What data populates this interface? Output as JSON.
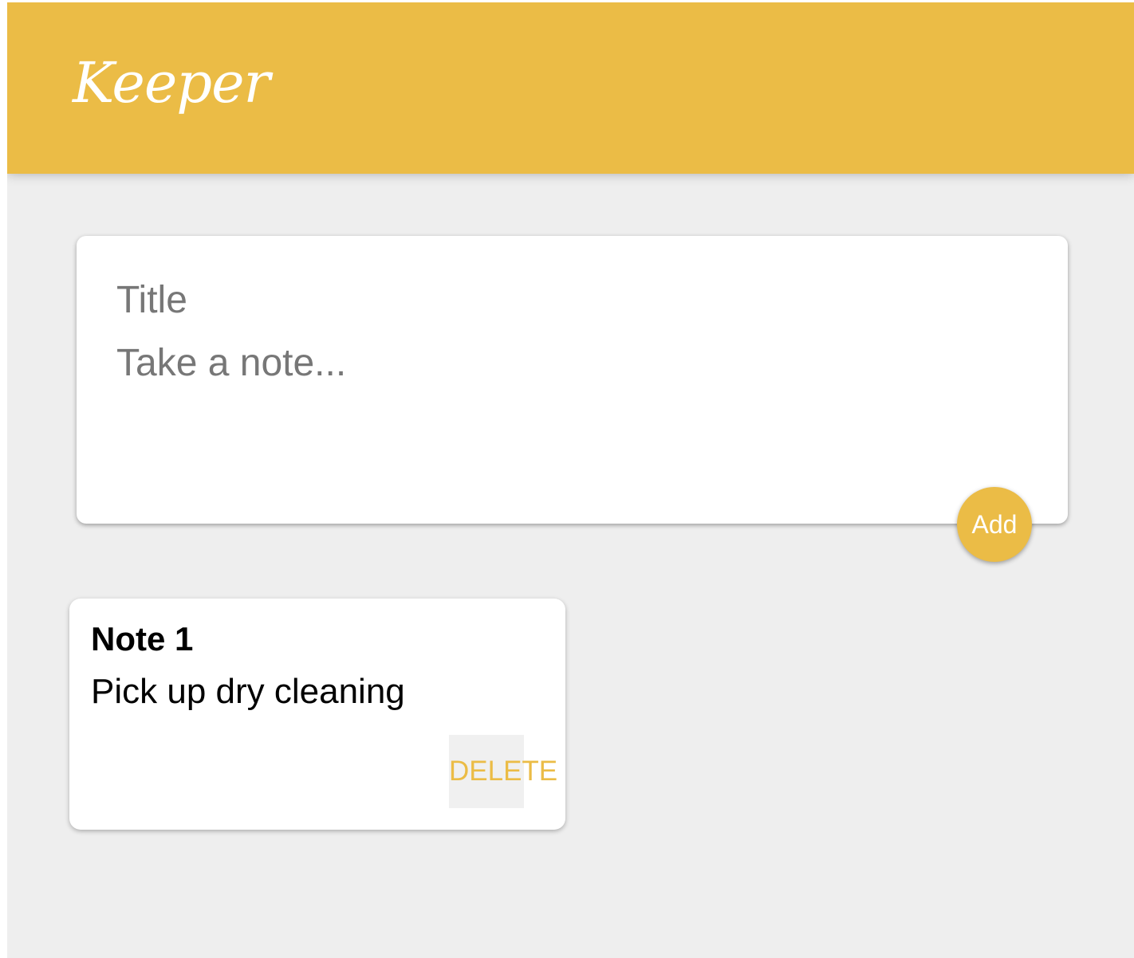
{
  "header": {
    "logo_text": "Keeper"
  },
  "create_area": {
    "title_placeholder": "Title",
    "content_placeholder": "Take a note...",
    "title_value": "",
    "content_value": "",
    "add_label": "Add"
  },
  "notes": [
    {
      "title": "Note 1",
      "content": "Pick up dry cleaning",
      "delete_label": "DELETE"
    }
  ],
  "colors": {
    "accent": "#ebbc46",
    "background": "#eeeeee",
    "card": "#ffffff",
    "delete_hover_bg": "#f0f0f0"
  }
}
